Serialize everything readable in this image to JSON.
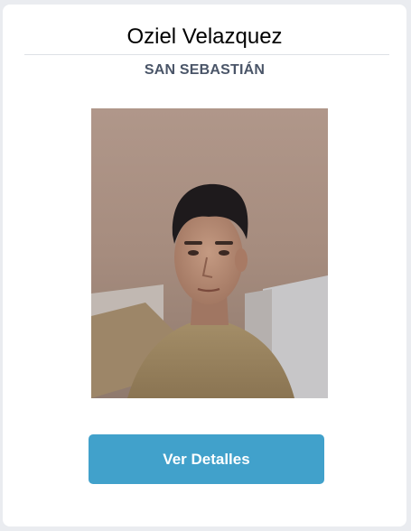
{
  "card": {
    "name": "Oziel Velazquez",
    "location": "SAN SEBASTIÁN",
    "details_button_label": "Ver Detalles"
  },
  "colors": {
    "page_background": "#eaecf0",
    "card_background": "#ffffff",
    "button_background": "#41a1cb",
    "button_text": "#ffffff",
    "location_text": "#4a5568"
  }
}
